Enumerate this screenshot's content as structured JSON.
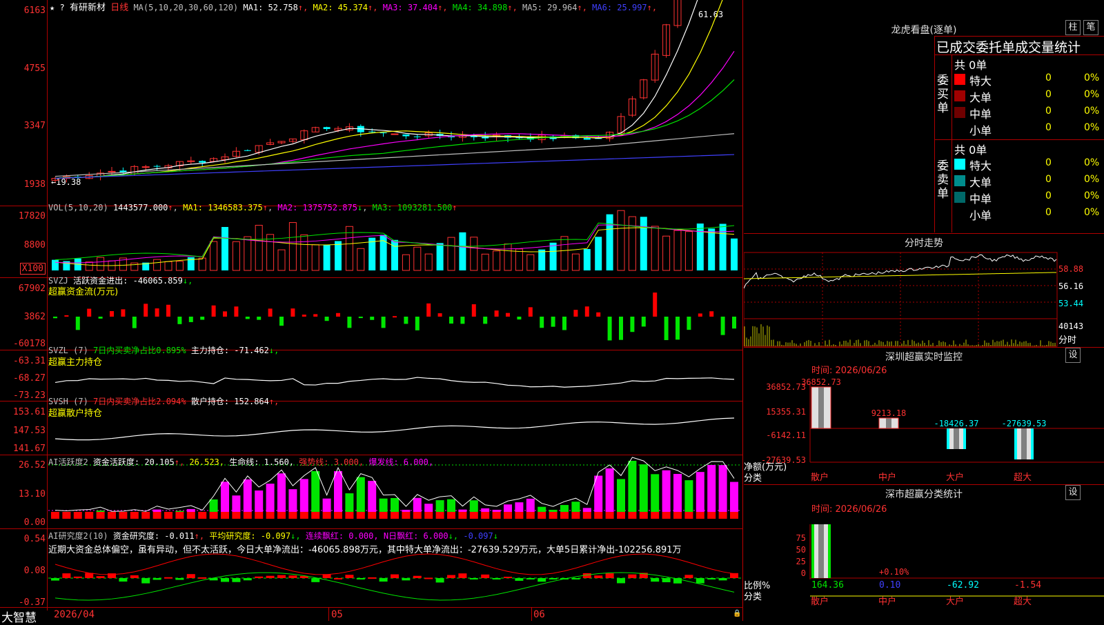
{
  "header": {
    "stock_name": "有研新材",
    "period": "日线",
    "ma_label": "MA(5,10,20,30,60,120)",
    "ma": [
      {
        "name": "MA1:",
        "value": "52.758",
        "arrow": "↑",
        "color": "#ffffff"
      },
      {
        "name": "MA2:",
        "value": "45.374",
        "arrow": "↑",
        "color": "#ffff00"
      },
      {
        "name": "MA3:",
        "value": "37.404",
        "arrow": "↑",
        "color": "#ff00ff"
      },
      {
        "name": "MA4:",
        "value": "34.898",
        "arrow": "↑",
        "color": "#00e600"
      },
      {
        "name": "MA5:",
        "value": "29.964",
        "arrow": "↑",
        "color": "#c0c0c0"
      },
      {
        "name": "MA6:",
        "value": "25.997",
        "arrow": "↑",
        "color": "#4040ff"
      }
    ],
    "high_mark": "61.63",
    "low_mark": "←19.38"
  },
  "axes": {
    "price": [
      "6163",
      "4755",
      "3347",
      "1938"
    ],
    "vol": [
      "17820",
      "8800",
      "X100"
    ],
    "svzj": [
      "67902",
      "3862",
      "-60178"
    ],
    "svzl": [
      "-63.31",
      "-68.27",
      "-73.23"
    ],
    "svsh": [
      "153.61",
      "147.53",
      "141.67"
    ],
    "ai": [
      "26.52",
      "13.10",
      "0.00"
    ],
    "research": [
      "0.54",
      "0.08",
      "-0.37"
    ]
  },
  "vol_header": {
    "label": "VOL(5,10,20)",
    "value": "1443577.000",
    "value_arrow": "↑",
    "ma1": "MA1: 1346583.375",
    "ma1_arrow": "↑",
    "ma2": "MA2: 1375752.875",
    "ma2_arrow": "↓",
    "ma3": "MA3: 1093281.500",
    "ma3_arrow": "↑"
  },
  "svzj_header": {
    "label": "SVZJ",
    "text": "活跃资金进出: -46065.859",
    "arrow": "↓,",
    "sub": "超赢资金流(万元)"
  },
  "svzl_header": {
    "label": "SVZL (7)",
    "ratio": "7日内买卖净占比0.895%",
    "text": "主力持仓: -71.462",
    "arrow": "↓,",
    "sub": "超赢主力持仓"
  },
  "svsh_header": {
    "label": "SVSH (7)",
    "ratio": "7日内买卖净占比2.094%",
    "text": "散户持仓: 152.864",
    "arrow": "↑,",
    "sub": "超赢散户持仓"
  },
  "ai_header": {
    "label": "AI活跃度2",
    "text": "资金活跃度: 20.105",
    "arrow1": "↑,",
    "v2": "26.523,",
    "life": "生命线: 1.560,",
    "strong": "强势线: 3.000,",
    "burst": "爆发线: 6.000,"
  },
  "research_header": {
    "label": "AI研究度2(10)",
    "text": "资金研究度: -0.011",
    "arrow1": "↑,",
    "avg": "平均研究度: -0.097",
    "arrow2": "↓,",
    "red_cont": "连续飘红: 0.000,",
    "n_red": "N日飘红: 6.000",
    "arrow3": "↓,",
    "last": "-0.097",
    "arrow4": "↓",
    "comment": "近期大资金总体偏空，虽有异动，但不太活跃，今日大单净流出：-46065.898万元，其中特大单净流出：-27639.529万元，大单5日累计净出-102256.891万"
  },
  "bottom": {
    "brand": "大智慧",
    "dates": [
      "2026/04",
      "05",
      "06"
    ]
  },
  "right": {
    "lhb_title": "龙虎看盘(逐单)",
    "btn1": "柱",
    "btn2": "笔",
    "stats_title": "已成交委托单成交量统计",
    "buy_label": "委买单",
    "sell_label": "委卖单",
    "buy_total": "共 0单",
    "sell_total": "共 0单",
    "buy_rows": [
      {
        "name": "特大",
        "count": "0",
        "pct": "0%",
        "color": "#ff0000"
      },
      {
        "name": "大单",
        "count": "0",
        "pct": "0%",
        "color": "#a00000"
      },
      {
        "name": "中单",
        "count": "0",
        "pct": "0%",
        "color": "#700000"
      },
      {
        "name": "小单",
        "count": "0",
        "pct": "0%",
        "color": "#000000"
      }
    ],
    "sell_rows": [
      {
        "name": "特大",
        "count": "0",
        "pct": "0%",
        "color": "#00ffff"
      },
      {
        "name": "大单",
        "count": "0",
        "pct": "0%",
        "color": "#008c8c"
      },
      {
        "name": "中单",
        "count": "0",
        "pct": "0%",
        "color": "#006868"
      },
      {
        "name": "小单",
        "count": "0",
        "pct": "0%",
        "color": "#000000"
      }
    ],
    "intraday_title": "分时走势",
    "intraday_axis": [
      "58.88",
      "56.16",
      "53.44",
      "40143",
      "分时"
    ],
    "sz_monitor_title": "深圳超赢实时监控",
    "sz_monitor_set": "设",
    "sz_monitor_time": "时间: 2026/06/26",
    "sz_monitor_axis": [
      "36852.73",
      "15355.31",
      "-6142.11",
      "-27639.53"
    ],
    "sz_monitor_unit": "净额(万元)",
    "sz_monitor_cat": "分类",
    "sz_monitor_bars": [
      {
        "label": "散户",
        "value": "36852.73"
      },
      {
        "label": "中户",
        "value": "9213.18"
      },
      {
        "label": "大户",
        "value": "-18426.37"
      },
      {
        "label": "超大",
        "value": "-27639.53"
      }
    ],
    "sz_class_title": "深市超赢分类统计",
    "sz_class_set": "设",
    "sz_class_time": "时间: 2026/06/26",
    "sz_class_axis": [
      "75",
      "50",
      "25",
      "0"
    ],
    "sz_class_unit": "比例%",
    "sz_class_cat": "分类",
    "sz_class_note": "+0.10%",
    "sz_class_bars": [
      {
        "label": "散户",
        "value": "164.36",
        "color": "#00e600"
      },
      {
        "label": "中户",
        "value": "0.10",
        "color": "#4040ff"
      },
      {
        "label": "大户",
        "value": "-62.92",
        "color": "#00ffff"
      },
      {
        "label": "超大",
        "value": "-1.54",
        "color": "#ff3232"
      }
    ]
  }
}
